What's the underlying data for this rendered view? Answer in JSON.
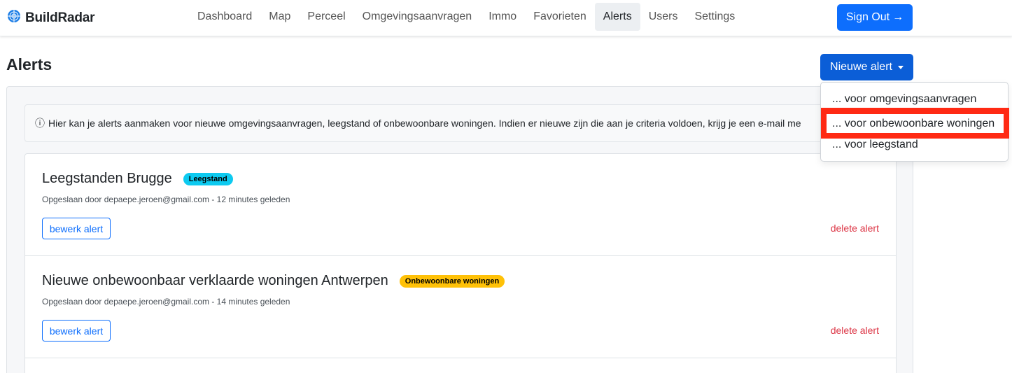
{
  "brand": {
    "name": "BuildRadar",
    "logo_color": "#1d7ee6"
  },
  "nav": {
    "items": [
      {
        "label": "Dashboard"
      },
      {
        "label": "Map"
      },
      {
        "label": "Perceel"
      },
      {
        "label": "Omgevingsaanvragen"
      },
      {
        "label": "Immo"
      },
      {
        "label": "Favorieten"
      },
      {
        "label": "Alerts",
        "active": true
      },
      {
        "label": "Users"
      },
      {
        "label": "Settings"
      }
    ],
    "sign_out": "Sign Out",
    "sign_out_arrow": "→"
  },
  "page": {
    "title": "Alerts",
    "new_alert_label": "Nieuwe alert",
    "info_icon": "ⓘ",
    "info_text": "Hier kan je alerts aanmaken voor nieuwe omgevingsaanvragen, leegstand of onbewoonbare woningen. Indien er nieuwe zijn die aan je criteria voldoen, krijg je een e-mail me"
  },
  "dropdown": {
    "items": [
      {
        "label": "... voor omgevingsaanvragen"
      },
      {
        "label": "... voor onbewoonbare woningen",
        "highlighted": true
      },
      {
        "label": "... voor leegstand"
      }
    ],
    "highlight_color": "#ff2a14"
  },
  "alerts": [
    {
      "title": "Leegstanden Brugge",
      "badge": "Leegstand",
      "badge_color": "#0dcaf0",
      "meta": "Opgeslaan door depaepe.jeroen@gmail.com - 12 minutes geleden",
      "edit_label": "bewerk alert",
      "delete_label": "delete alert"
    },
    {
      "title": "Nieuwe onbewoonbaar verklaarde woningen Antwerpen",
      "badge": "Onbewoonbare woningen",
      "badge_color": "#ffc107",
      "meta": "Opgeslaan door depaepe.jeroen@gmail.com - 14 minutes geleden",
      "edit_label": "bewerk alert",
      "delete_label": "delete alert"
    }
  ],
  "colors": {
    "primary": "#0d6efd",
    "danger": "#dc3545"
  }
}
